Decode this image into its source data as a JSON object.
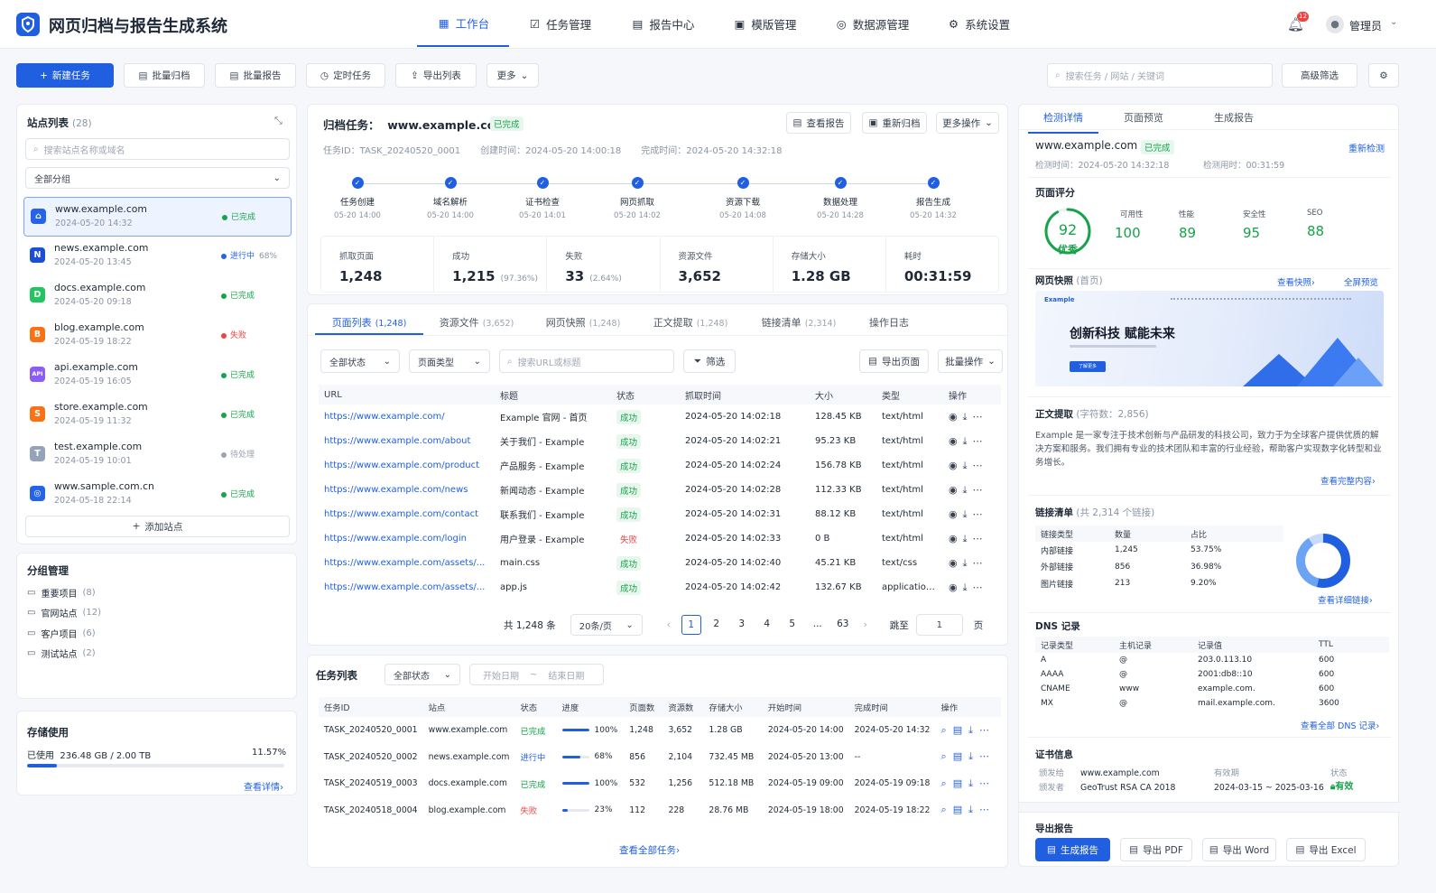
{
  "app": {
    "title": "网页归档与报告生成系统",
    "badge_count": "12",
    "user": "管理员"
  },
  "nav": [
    {
      "label": "工作台"
    },
    {
      "label": "任务管理"
    },
    {
      "label": "报告中心"
    },
    {
      "label": "模版管理"
    },
    {
      "label": "数据源管理"
    },
    {
      "label": "系统设置"
    }
  ],
  "toolbar": {
    "new_task": "新建任务",
    "batch_archive": "批量归档",
    "batch_report": "批量报告",
    "scheduled": "定时任务",
    "export_list": "导出列表",
    "more": "更多",
    "search_placeholder": "搜索任务 / 网站 / 关键词",
    "adv_filter": "高级筛选"
  },
  "sites": {
    "title": "站点列表",
    "count": "(28)",
    "search_placeholder": "搜索站点名称或域名",
    "group": "全部分组",
    "add": "添加站点",
    "items": [
      {
        "letter": "⌂",
        "name": "www.example.com",
        "date": "2024-05-20 14:32",
        "status": "已完成",
        "pct": "",
        "color": "#2563eb",
        "sc": "#16a34a"
      },
      {
        "letter": "N",
        "name": "news.example.com",
        "date": "2024-05-20 13:45",
        "status": "进行中",
        "pct": "68%",
        "color": "#1d4ed8",
        "sc": "#2563eb"
      },
      {
        "letter": "D",
        "name": "docs.example.com",
        "date": "2024-05-20 09:18",
        "status": "已完成",
        "pct": "",
        "color": "#22c55e",
        "sc": "#16a34a"
      },
      {
        "letter": "B",
        "name": "blog.example.com",
        "date": "2024-05-19 18:22",
        "status": "失败",
        "pct": "",
        "color": "#f97316",
        "sc": "#ef4444"
      },
      {
        "letter": "API",
        "name": "api.example.com",
        "date": "2024-05-19 16:05",
        "status": "已完成",
        "pct": "",
        "color": "#8b5cf6",
        "sc": "#16a34a"
      },
      {
        "letter": "S",
        "name": "store.example.com",
        "date": "2024-05-19 11:32",
        "status": "已完成",
        "pct": "",
        "color": "#f97316",
        "sc": "#16a34a"
      },
      {
        "letter": "T",
        "name": "test.example.com",
        "date": "2024-05-19 10:01",
        "status": "待处理",
        "pct": "",
        "color": "#94a3b8",
        "sc": "#9ca3af"
      },
      {
        "letter": "◎",
        "name": "www.sample.com.cn",
        "date": "2024-05-18 22:14",
        "status": "已完成",
        "pct": "",
        "color": "#2563eb",
        "sc": "#16a34a"
      }
    ]
  },
  "groups": {
    "title": "分组管理",
    "items": [
      {
        "name": "重要项目",
        "count": "(8)"
      },
      {
        "name": "官网站点",
        "count": "(12)"
      },
      {
        "name": "客户项目",
        "count": "(6)"
      },
      {
        "name": "测试站点",
        "count": "(2)"
      }
    ]
  },
  "storage": {
    "title": "存储使用",
    "used_label": "已使用",
    "used": "236.48 GB / 2.00 TB",
    "pct": "11.57%",
    "fill": 0.1157,
    "link": "查看详情"
  },
  "task": {
    "label": "归档任务：",
    "domain": "www.example.com",
    "status": "已完成",
    "view_report": "查看报告",
    "rearchive": "重新归档",
    "more": "更多操作",
    "id": "任务ID：TASK_20240520_0001",
    "created": "创建时间：2024-05-20 14:00:18",
    "finished": "完成时间：2024-05-20 14:32:18",
    "steps": [
      {
        "name": "任务创建",
        "time": "05-20 14:00"
      },
      {
        "name": "域名解析",
        "time": "05-20 14:00"
      },
      {
        "name": "证书检查",
        "time": "05-20 14:01"
      },
      {
        "name": "网页抓取",
        "time": "05-20 14:02"
      },
      {
        "name": "资源下载",
        "time": "05-20 14:08"
      },
      {
        "name": "数据处理",
        "time": "05-20 14:28"
      },
      {
        "name": "报告生成",
        "time": "05-20 14:32"
      }
    ],
    "stats": [
      {
        "label": "抓取页面",
        "value": "1,248",
        "sub": ""
      },
      {
        "label": "成功",
        "value": "1,215",
        "sub": "(97.36%)"
      },
      {
        "label": "失败",
        "value": "33",
        "sub": "(2.64%)"
      },
      {
        "label": "资源文件",
        "value": "3,652",
        "sub": ""
      },
      {
        "label": "存储大小",
        "value": "1.28 GB",
        "sub": ""
      },
      {
        "label": "耗时",
        "value": "00:31:59",
        "sub": ""
      }
    ]
  },
  "pages": {
    "tabs": [
      {
        "label": "页面列表",
        "count": "(1,248)"
      },
      {
        "label": "资源文件",
        "count": "(3,652)"
      },
      {
        "label": "网页快照",
        "count": "(1,248)"
      },
      {
        "label": "正文提取",
        "count": "(1,248)"
      },
      {
        "label": "链接清单",
        "count": "(2,314)"
      },
      {
        "label": "操作日志",
        "count": ""
      }
    ],
    "f_status": "全部状态",
    "f_type": "页面类型",
    "f_search": "搜索URL或标题",
    "f_filter": "筛选",
    "export": "导出页面",
    "batch": "批量操作",
    "headers": [
      "URL",
      "标题",
      "状态",
      "抓取时间",
      "大小",
      "类型",
      "操作"
    ],
    "rows": [
      {
        "url": "https://www.example.com/",
        "title": "Example 官网 - 首页",
        "status": "成功",
        "time": "2024-05-20 14:02:18",
        "size": "128.45 KB",
        "type": "text/html"
      },
      {
        "url": "https://www.example.com/about",
        "title": "关于我们 - Example",
        "status": "成功",
        "time": "2024-05-20 14:02:21",
        "size": "95.23 KB",
        "type": "text/html"
      },
      {
        "url": "https://www.example.com/product",
        "title": "产品服务 - Example",
        "status": "成功",
        "time": "2024-05-20 14:02:24",
        "size": "156.78 KB",
        "type": "text/html"
      },
      {
        "url": "https://www.example.com/news",
        "title": "新闻动态 - Example",
        "status": "成功",
        "time": "2024-05-20 14:02:28",
        "size": "112.33 KB",
        "type": "text/html"
      },
      {
        "url": "https://www.example.com/contact",
        "title": "联系我们 - Example",
        "status": "成功",
        "time": "2024-05-20 14:02:31",
        "size": "88.12 KB",
        "type": "text/html"
      },
      {
        "url": "https://www.example.com/login",
        "title": "用户登录 - Example",
        "status": "失败",
        "time": "2024-05-20 14:02:33",
        "size": "0 B",
        "type": "text/html"
      },
      {
        "url": "https://www.example.com/assets/...",
        "title": "main.css",
        "status": "成功",
        "time": "2024-05-20 14:02:40",
        "size": "45.21 KB",
        "type": "text/css"
      },
      {
        "url": "https://www.example.com/assets/...",
        "title": "app.js",
        "status": "成功",
        "time": "2024-05-20 14:02:42",
        "size": "132.67 KB",
        "type": "application/..."
      }
    ],
    "total": "共 1,248 条",
    "per_page": "20条/页",
    "pagers": [
      "1",
      "2",
      "3",
      "4",
      "5",
      "...",
      "63"
    ],
    "goto": "跳至",
    "goto_val": "1",
    "page_unit": "页"
  },
  "tasks": {
    "title": "任务列表",
    "f_status": "全部状态",
    "start": "开始日期",
    "tilde": "~",
    "end": "结束日期",
    "headers": [
      "任务ID",
      "站点",
      "状态",
      "进度",
      "页面数",
      "资源数",
      "存储大小",
      "开始时间",
      "完成时间",
      "操作"
    ],
    "rows": [
      {
        "id": "TASK_20240520_0001",
        "site": "www.example.com",
        "status": "已完成",
        "prog": "100%",
        "fill": 1,
        "pages": "1,248",
        "res": "3,652",
        "size": "1.28 GB",
        "start": "2024-05-20 14:00",
        "end": "2024-05-20 14:32",
        "sc": "#16a34a"
      },
      {
        "id": "TASK_20240520_0002",
        "site": "news.example.com",
        "status": "进行中",
        "prog": "68%",
        "fill": 0.68,
        "pages": "856",
        "res": "2,104",
        "size": "732.45 MB",
        "start": "2024-05-20 13:00",
        "end": "--",
        "sc": "#2563eb"
      },
      {
        "id": "TASK_20240519_0003",
        "site": "docs.example.com",
        "status": "已完成",
        "prog": "100%",
        "fill": 1,
        "pages": "532",
        "res": "1,256",
        "size": "512.18 MB",
        "start": "2024-05-19 09:00",
        "end": "2024-05-19 09:18",
        "sc": "#16a34a"
      },
      {
        "id": "TASK_20240518_0004",
        "site": "blog.example.com",
        "status": "失败",
        "prog": "23%",
        "fill": 0.23,
        "pages": "112",
        "res": "228",
        "size": "28.76 MB",
        "start": "2024-05-19 18:00",
        "end": "2024-05-19 18:22",
        "sc": "#ef4444"
      }
    ],
    "view_all": "查看全部任务"
  },
  "detail": {
    "tabs": [
      "检测详情",
      "页面预览",
      "生成报告"
    ],
    "domain": "www.example.com",
    "status": "已完成",
    "recheck": "重新检测",
    "check_time": "检测时间：2024-05-20 14:32:18",
    "duration": "检测用时：00:31:59",
    "score_title": "页面评分",
    "score": "92",
    "score_level": "优秀",
    "score_fill": 0.92,
    "metrics": [
      {
        "label": "可用性",
        "value": "100"
      },
      {
        "label": "性能",
        "value": "89"
      },
      {
        "label": "安全性",
        "value": "95"
      },
      {
        "label": "SEO",
        "value": "88"
      }
    ],
    "snap_title": "网页快照",
    "snap_sub": "(首页)",
    "snap_view": "查看快照",
    "snap_full": "全屏预览",
    "snap_logo": "Example",
    "snap_headline": "创新科技 赋能未来",
    "snap_cta": "了解更多",
    "text_title": "正文提取",
    "text_count": "(字符数：2,856)",
    "text_body": "Example 是一家专注于技术创新与产品研发的科技公司，致力于为全球客户提供优质的解决方案和服务。我们拥有专业的技术团队和丰富的行业经验，帮助客户实现数字化转型和业务增长。",
    "text_link": "查看完整内容",
    "links_title": "链接清单",
    "links_total": "(共 2,314 个链接)",
    "links_headers": [
      "链接类型",
      "数量",
      "占比"
    ],
    "links": [
      {
        "type": "内部链接",
        "count": "1,245",
        "pct": "53.75%",
        "value": 53.75,
        "color": "#1f5fe0"
      },
      {
        "type": "外部链接",
        "count": "856",
        "pct": "36.98%",
        "value": 36.98,
        "color": "#6da3f5"
      },
      {
        "type": "图片链接",
        "count": "213",
        "pct": "9.20%",
        "value": 9.2,
        "color": "#c8dbfb"
      }
    ],
    "links_more": "查看详细链接",
    "dns_title": "DNS 记录",
    "dns_headers": [
      "记录类型",
      "主机记录",
      "记录值",
      "TTL"
    ],
    "dns": [
      {
        "t": "A",
        "h": "@",
        "v": "203.0.113.10",
        "ttl": "600"
      },
      {
        "t": "AAAA",
        "h": "@",
        "v": "2001:db8::10",
        "ttl": "600"
      },
      {
        "t": "CNAME",
        "h": "www",
        "v": "example.com.",
        "ttl": "600"
      },
      {
        "t": "MX",
        "h": "@",
        "v": "mail.example.com.",
        "ttl": "3600"
      }
    ],
    "dns_more": "查看全部 DNS 记录",
    "cert_title": "证书信息",
    "cert_to_label": "颁发给",
    "cert_to": "www.example.com",
    "cert_by_label": "颁发者",
    "cert_by": "GeoTrust RSA CA 2018",
    "cert_valid_label": "有效期",
    "cert_valid": "2024-03-15 ~ 2025-03-16",
    "cert_state_label": "状态",
    "cert_state": "有效",
    "export_title": "导出报告",
    "gen": "生成报告",
    "pdf": "导出 PDF",
    "word": "导出 Word",
    "excel": "导出 Excel"
  }
}
